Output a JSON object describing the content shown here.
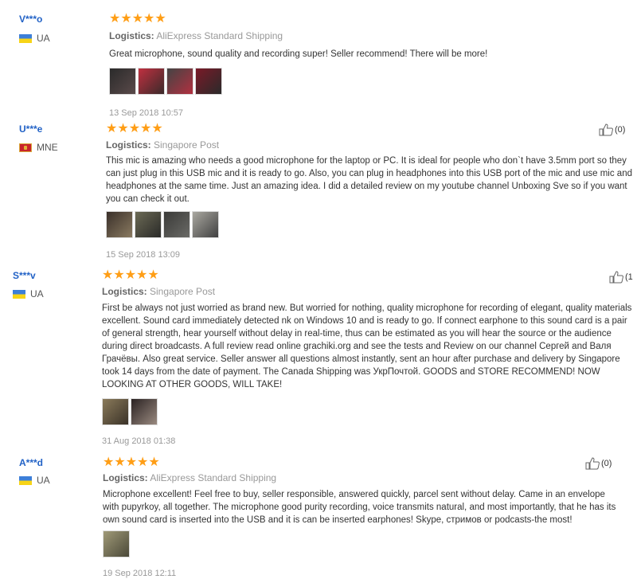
{
  "reviews": [
    {
      "user": "V***o",
      "country": "UA",
      "stars": "★★★★★",
      "logistics_label": "Logistics:",
      "logistics_value": "AliExpress Standard Shipping",
      "text": "Great microphone, sound quality and recording super! Seller recommend! There will be more!",
      "date": "13 Sep 2018 10:57",
      "helpful": "",
      "photos": [
        "#3a2a2a",
        "#b22a3a",
        "#3b3b3b",
        "#6a1a22"
      ]
    },
    {
      "user": "U***e",
      "country": "MNE",
      "stars": "★★★★★",
      "logistics_label": "Logistics:",
      "logistics_value": "Singapore Post",
      "text": "This mic is amazing who needs a good microphone for the laptop or PC. It is ideal for people who don`t have 3.5mm port so they can just plug in this USB mic and it is ready to go. Also, you can plug in headphones into this USB port of the mic and use mic and headphones at the same time. Just an amazing idea. I did a detailed review on my youtube channel Unboxing Sve so if you want you can check it out.",
      "date": "15 Sep 2018 13:09",
      "helpful": "(0)",
      "photos": [
        "#5a4a3a",
        "#6b6a55",
        "#4a4a48",
        "#8a8a80"
      ]
    },
    {
      "user": "S***v",
      "country": "UA",
      "stars": "★★★★★",
      "logistics_label": "Logistics:",
      "logistics_value": "Singapore Post",
      "text": "First be always not just worried as brand new. But worried for nothing, quality microphone for recording of elegant, quality materials excellent. Sound card immediately detected nk on Windows 10 and is ready to go. If connect earphone to this sound card is a pair of general strength, hear yourself without delay in real-time, thus can be estimated as you will hear the source or the audience during direct broadcasts. A full review read online grachiki.org and see the tests and Review on our channel Сергей and Валя Грачёвы. Also great service. Seller answer all questions almost instantly, sent an hour after purchase and delivery by Singapore took 14 days from the date of payment. The Canada Shipping was УкрПочтой. GOODS and STORE RECOMMEND! NOW LOOKING AT OTHER GOODS, WILL TAKE!",
      "date": "31 Aug 2018 01:38",
      "helpful": "(1",
      "photos": [
        "#6e6450",
        "#5a4a42"
      ]
    },
    {
      "user": "A***d",
      "country": "UA",
      "stars": "★★★★★",
      "logistics_label": "Logistics:",
      "logistics_value": "AliExpress Standard Shipping",
      "text": "Microphone excellent! Feel free to buy, seller responsible, answered quickly, parcel sent without delay. Came in an envelope with pupyrkoy, all together. The microphone good purity recording, voice transmits natural, and most importantly, that he has its own sound card is inserted into the USB and it is can be inserted earphones! Skype, стримов or podcasts-the most!",
      "date": "19 Sep 2018 12:11",
      "helpful": "(0)",
      "photos": [
        "#8a8466"
      ]
    }
  ]
}
